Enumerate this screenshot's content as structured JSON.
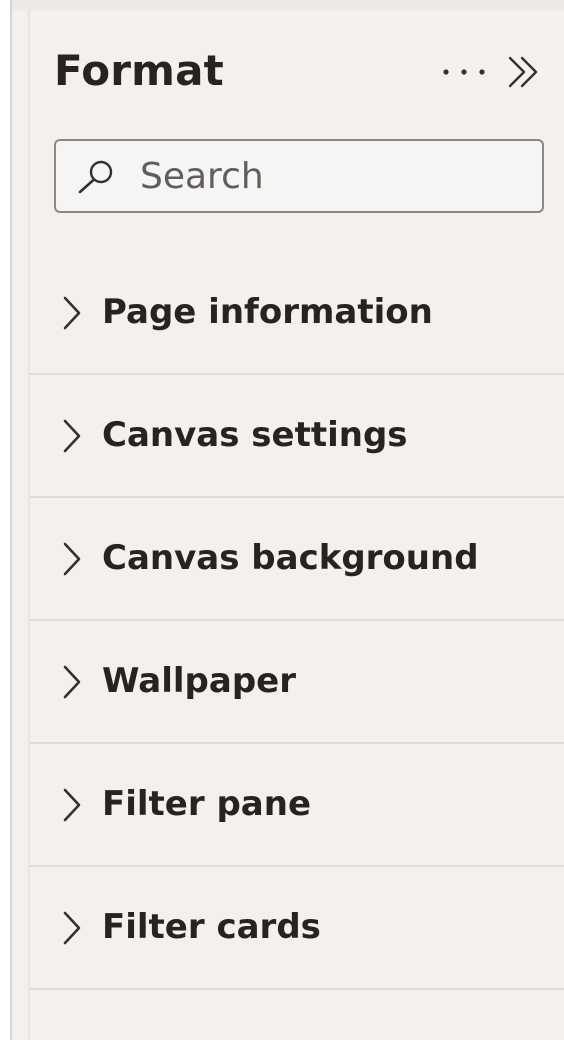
{
  "panel": {
    "title": "Format"
  },
  "header_actions": {
    "more_icon": "ellipsis-icon",
    "expand_icon": "double-chevron-right-icon"
  },
  "search": {
    "placeholder": "Search",
    "value": "",
    "icon": "search-icon"
  },
  "sections": [
    {
      "label": "Page information",
      "icon": "chevron-right-icon",
      "expanded": false
    },
    {
      "label": "Canvas settings",
      "icon": "chevron-right-icon",
      "expanded": false
    },
    {
      "label": "Canvas background",
      "icon": "chevron-right-icon",
      "expanded": false
    },
    {
      "label": "Wallpaper",
      "icon": "chevron-right-icon",
      "expanded": false
    },
    {
      "label": "Filter pane",
      "icon": "chevron-right-icon",
      "expanded": false
    },
    {
      "label": "Filter cards",
      "icon": "chevron-right-icon",
      "expanded": false
    }
  ],
  "colors": {
    "panel_background": "#f3f0ed",
    "text": "#252423",
    "divider": "#e0ddd9",
    "search_border": "#8a8886"
  }
}
